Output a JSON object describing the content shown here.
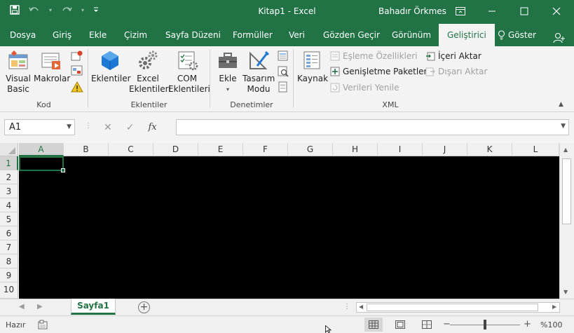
{
  "titlebar": {
    "title": "Kitap1  -  Excel",
    "user": "Bahadır Örkmes"
  },
  "tabs": [
    {
      "label": "Dosya"
    },
    {
      "label": "Giriş"
    },
    {
      "label": "Ekle"
    },
    {
      "label": "Çizim"
    },
    {
      "label": "Sayfa Düzeni"
    },
    {
      "label": "Formüller"
    },
    {
      "label": "Veri"
    },
    {
      "label": "Gözden Geçir"
    },
    {
      "label": "Görünüm"
    },
    {
      "label": "Geliştirici"
    },
    {
      "label": "Göster"
    }
  ],
  "ribbon": {
    "kod": {
      "label": "Kod",
      "visual_basic": "Visual\nBasic",
      "makrolar": "Makrolar"
    },
    "eklentiler": {
      "label": "Eklentiler",
      "eklentiler": "Eklentiler",
      "excel_eklentileri": "Excel\nEklentileri",
      "com_eklentileri": "COM\nEklentileri"
    },
    "denetimler": {
      "label": "Denetimler",
      "ekle": "Ekle",
      "tasarim_modu": "Tasarım\nModu"
    },
    "xml": {
      "label": "XML",
      "kaynak": "Kaynak",
      "esleme_ozellikleri": "Eşleme Özellikleri",
      "genisletme_paketleri": "Genişletme Paketleri",
      "verileri_yenile": "Verileri Yenile",
      "iceri_aktar": "İçeri Aktar",
      "disari_aktar": "Dışarı Aktar"
    }
  },
  "formula_bar": {
    "name_box": "A1",
    "fx": "fx",
    "value": ""
  },
  "grid": {
    "columns": [
      "A",
      "B",
      "C",
      "D",
      "E",
      "F",
      "G",
      "H",
      "I",
      "J",
      "K",
      "L"
    ],
    "rows": [
      "1",
      "2",
      "3",
      "4",
      "5",
      "6",
      "7",
      "8",
      "9",
      "10"
    ],
    "active_cell": "A1"
  },
  "sheets": [
    {
      "name": "Sayfa1",
      "active": true
    }
  ],
  "status": {
    "ready": "Hazır",
    "zoom": "%100"
  },
  "colors": {
    "accent": "#217346",
    "ribbon_bg": "#f3f3f3",
    "cells_bg": "#000000"
  }
}
